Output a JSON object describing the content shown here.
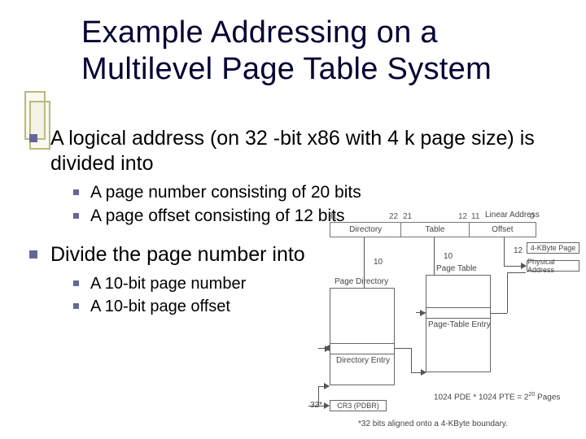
{
  "title": "Example Addressing on a Multilevel Page Table System",
  "bullets": [
    {
      "text": "A logical address (on 32 -bit x86 with 4 k page size) is divided into",
      "sub": [
        "A page number consisting of 20 bits",
        "A page offset consisting of 12 bits"
      ]
    },
    {
      "text": "Divide the page number into",
      "sub": [
        "A 10-bit page number",
        "A 10-bit page offset"
      ]
    }
  ],
  "diagram": {
    "linear_address_label": "Linear Address",
    "bit_numbers": {
      "b31": "31",
      "b22": "22",
      "b21": "21",
      "b12": "12",
      "b11": "11",
      "b0": "0"
    },
    "segments": {
      "directory": "Directory",
      "table": "Table",
      "offset": "Offset"
    },
    "widths": {
      "w10a": "10",
      "w10b": "10",
      "w12": "12"
    },
    "page_directory": "Page Directory",
    "page_table": "Page Table",
    "page4k": "4-KByte Page",
    "physical_address": "Physical Address",
    "directory_entry": "Directory Entry",
    "page_table_entry": "Page-Table Entry",
    "cr3": "CR3 (PDBR)",
    "thirty_two_star": "32*",
    "pde_pte_prefix": "1024 PDE * 1024 PTE = 2",
    "pde_pte_exp": "20",
    "pde_pte_suffix": " Pages",
    "footnote": "*32 bits aligned onto a 4-KByte boundary."
  }
}
